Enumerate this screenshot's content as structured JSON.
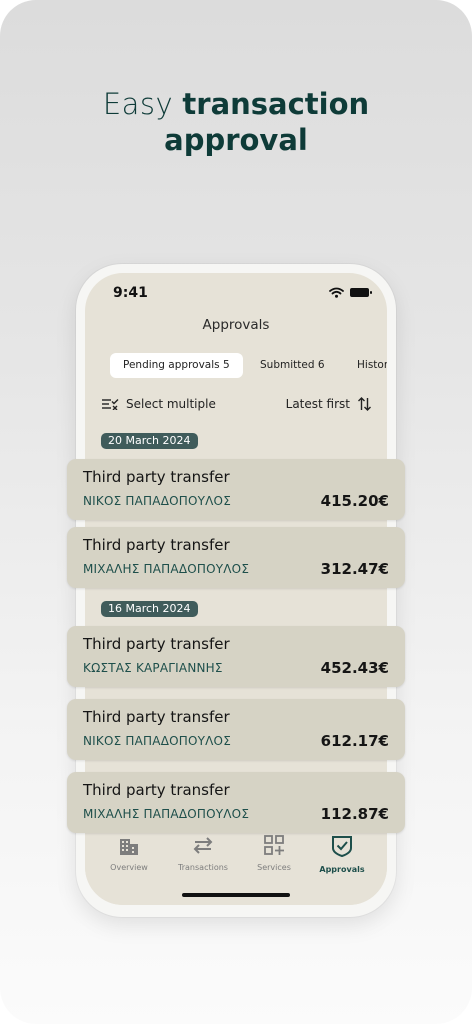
{
  "headline": {
    "light": "Easy",
    "bold1": "transaction",
    "bold2": "approval"
  },
  "status": {
    "time": "9:41"
  },
  "screen": {
    "title": "Approvals"
  },
  "tabs": [
    {
      "label": "Pending approvals 5"
    },
    {
      "label": "Submitted 6"
    },
    {
      "label": "History"
    }
  ],
  "toolbar": {
    "select_label": "Select multiple",
    "sort_label": "Latest first"
  },
  "groups": [
    {
      "date": "20 March 2024"
    },
    {
      "date": "16 March 2024"
    }
  ],
  "transactions": [
    {
      "title": "Third party transfer",
      "name": "ΝΙΚΟΣ ΠΑΠΑΔΟΠΟΥΛΟΣ",
      "amount": "415.20€"
    },
    {
      "title": "Third party transfer",
      "name": "ΜΙΧΑΛΗΣ ΠΑΠΑΔΟΠΟΥΛΟΣ",
      "amount": "312.47€"
    },
    {
      "title": "Third party transfer",
      "name": "ΚΩΣΤΑΣ ΚΑΡΑΓΙΑΝΝΗΣ",
      "amount": "452.43€"
    },
    {
      "title": "Third party transfer",
      "name": "ΝΙΚΟΣ ΠΑΠΑΔΟΠΟΥΛΟΣ",
      "amount": "612.17€"
    },
    {
      "title": "Third party transfer",
      "name": "ΜΙΧΑΛΗΣ ΠΑΠΑΔΟΠΟΥΛΟΣ",
      "amount": "112.87€"
    }
  ],
  "tabbar": [
    {
      "label": "Overview",
      "icon": "building-icon"
    },
    {
      "label": "Transactions",
      "icon": "transfer-arrows-icon"
    },
    {
      "label": "Services",
      "icon": "grid-plus-icon"
    },
    {
      "label": "Approvals",
      "icon": "shield-check-icon",
      "active": true
    }
  ],
  "colors": {
    "accent": "#1e4f4b",
    "screen_bg": "#e6e2d7",
    "card_bg": "#d6d3c5",
    "date_pill": "#405c5b"
  }
}
